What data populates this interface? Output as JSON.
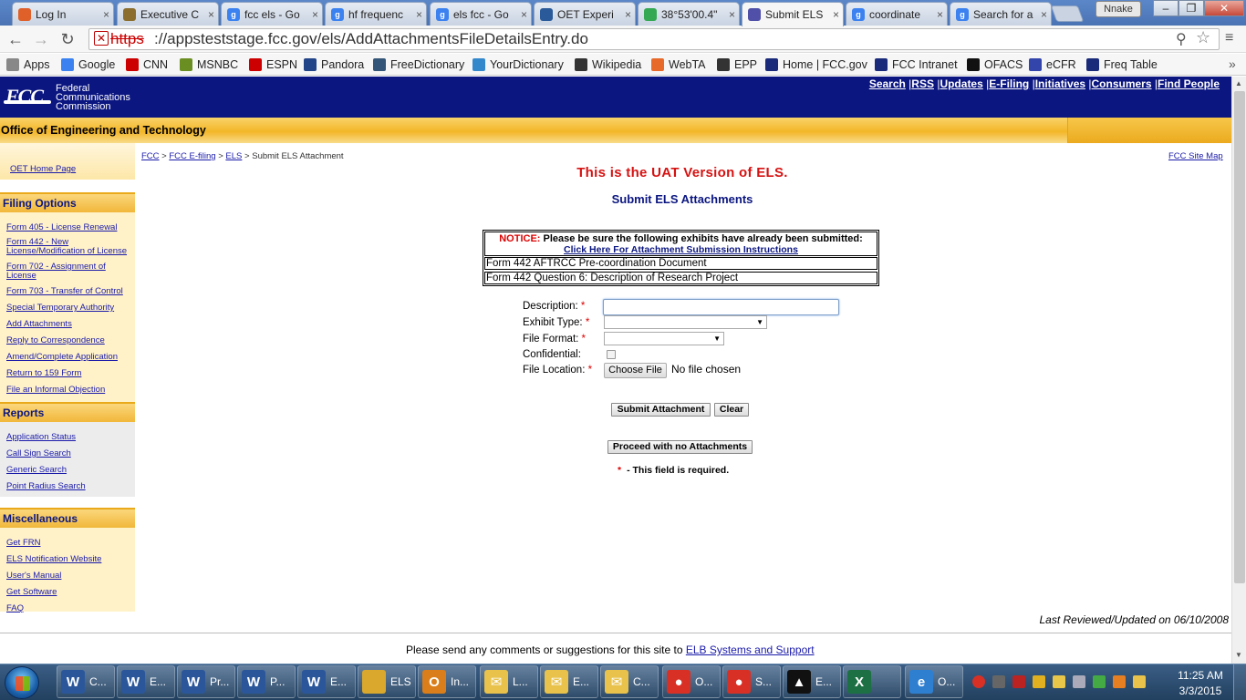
{
  "browser": {
    "tabs": [
      {
        "title": "Log In",
        "color": "#e0602a",
        "glyph": ""
      },
      {
        "title": "Executive C",
        "color": "#8b6d2e",
        "glyph": ""
      },
      {
        "title": "fcc els - Go",
        "color": "#3b82f0",
        "glyph": "g"
      },
      {
        "title": "hf frequenc",
        "color": "#3b82f0",
        "glyph": "g"
      },
      {
        "title": "els fcc - Go",
        "color": "#3b82f0",
        "glyph": "g"
      },
      {
        "title": "OET Experi",
        "color": "#2a5a9a",
        "glyph": ""
      },
      {
        "title": "38°53'00.4\"",
        "color": "#34a853",
        "glyph": ""
      },
      {
        "title": "Submit ELS",
        "color": "#5050a8",
        "glyph": ""
      },
      {
        "title": "coordinate",
        "color": "#3b82f0",
        "glyph": "g"
      },
      {
        "title": "Search for a",
        "color": "#3b82f0",
        "glyph": "g"
      }
    ],
    "active_tab": 7,
    "user": "Nnake",
    "url_scheme": "https",
    "url_rest": "://appsteststage.fcc.gov/els/AddAttachmentsFileDetailsEntry.do",
    "bookmarks": [
      {
        "label": "Apps",
        "color": "#888888"
      },
      {
        "label": "Google",
        "color": "#3b82f0"
      },
      {
        "label": "CNN",
        "color": "#cc0000"
      },
      {
        "label": "MSNBC",
        "color": "#6b8e23"
      },
      {
        "label": "ESPN",
        "color": "#cc0000"
      },
      {
        "label": "Pandora",
        "color": "#224488"
      },
      {
        "label": "FreeDictionary",
        "color": "#335577"
      },
      {
        "label": "YourDictionary",
        "color": "#3388cc"
      },
      {
        "label": "Wikipedia",
        "color": "#333333"
      },
      {
        "label": "WebTA",
        "color": "#e86a2a"
      },
      {
        "label": "EPP",
        "color": "#333333"
      },
      {
        "label": "Home | FCC.gov",
        "color": "#1a2a7a"
      },
      {
        "label": "FCC Intranet",
        "color": "#1a2a7a"
      },
      {
        "label": "OFACS",
        "color": "#111111"
      },
      {
        "label": "eCFR",
        "color": "#3344aa"
      },
      {
        "label": "Freq Table",
        "color": "#1a2a7a"
      }
    ]
  },
  "header": {
    "logo": "FCC",
    "name_lines": [
      "Federal",
      "Communications",
      "Commission"
    ],
    "links": [
      "Search",
      "RSS",
      "Updates",
      "E-Filing",
      "Initiatives",
      "Consumers",
      "Find People"
    ],
    "office": "Office of Engineering and Technology"
  },
  "sidebar": {
    "home": "OET Home Page",
    "filing_title": "Filing Options",
    "filing": [
      "Form 405 - License Renewal",
      "Form 442 - New License/Modification of License",
      "Form 702 - Assignment of License",
      "Form 703 - Transfer of Control",
      "Special Temporary Authority",
      "Add Attachments",
      "Reply to Correspondence",
      "Amend/Complete Application",
      "Return to 159 Form",
      "File an Informal Objection"
    ],
    "reports_title": "Reports",
    "reports": [
      "Application Status",
      "Call Sign Search",
      "Generic Search",
      "Point Radius Search"
    ],
    "misc_title": "Miscellaneous",
    "misc": [
      "Get FRN",
      "ELS Notification Website",
      "User's Manual",
      "Get Software",
      "FAQ"
    ]
  },
  "breadcrumb": {
    "items": [
      "FCC",
      "FCC E-filing",
      "ELS"
    ],
    "current": "Submit ELS Attachment",
    "sep": ">"
  },
  "sitemap": "FCC Site Map",
  "uat_notice": "This is the UAT Version of ELS.",
  "page_title": "Submit ELS Attachments",
  "notice": {
    "label": "NOTICE:",
    "text": " Please be sure the following exhibits have already been submitted:",
    "link": "Click Here For Attachment Submission Instructions",
    "items": [
      "Form 442 AFTRCC Pre-coordination Document",
      "Form 442 Question 6: Description of Research Project"
    ]
  },
  "form": {
    "description_label": "Description:",
    "exhibit_label": "Exhibit Type:",
    "format_label": "File Format:",
    "confidential_label": "Confidential:",
    "location_label": "File Location:",
    "description_value": "",
    "exhibit_value": "",
    "format_value": "",
    "confidential": false,
    "choose_file": "Choose File",
    "no_file": "No file chosen",
    "required_star": "*",
    "submit_label": "Submit Attachment",
    "clear_label": "Clear",
    "proceed_label": "Proceed with no Attachments",
    "required_note": "- This field is required."
  },
  "reviewed": "Last Reviewed/Updated on 06/10/2008",
  "footer": {
    "text": "Please send any comments or suggestions for this site to ",
    "link": "ELB Systems and Support"
  },
  "taskbar": {
    "items": [
      {
        "label": "C...",
        "color": "#2b579a",
        "glyph": "W"
      },
      {
        "label": "E...",
        "color": "#2b579a",
        "glyph": "W"
      },
      {
        "label": "Pr...",
        "color": "#2b579a",
        "glyph": "W"
      },
      {
        "label": "P...",
        "color": "#2b579a",
        "glyph": "W"
      },
      {
        "label": "E...",
        "color": "#2b579a",
        "glyph": "W"
      },
      {
        "label": "ELS",
        "color": "#d9a82c",
        "glyph": ""
      },
      {
        "label": "In...",
        "color": "#d97e1a",
        "glyph": "O"
      },
      {
        "label": "L...",
        "color": "#e8c24a",
        "glyph": "✉"
      },
      {
        "label": "E...",
        "color": "#e8c24a",
        "glyph": "✉"
      },
      {
        "label": "C...",
        "color": "#e8c24a",
        "glyph": "✉"
      },
      {
        "label": "O...",
        "color": "#d93025",
        "glyph": "●"
      },
      {
        "label": "S...",
        "color": "#d93025",
        "glyph": "●"
      },
      {
        "label": "E...",
        "color": "#111111",
        "glyph": "▲"
      },
      {
        "label": "",
        "color": "#1d7044",
        "glyph": "X"
      },
      {
        "label": "O...",
        "color": "#2f7fd0",
        "glyph": "e"
      }
    ],
    "time": "11:25 AM",
    "date": "3/3/2015"
  }
}
